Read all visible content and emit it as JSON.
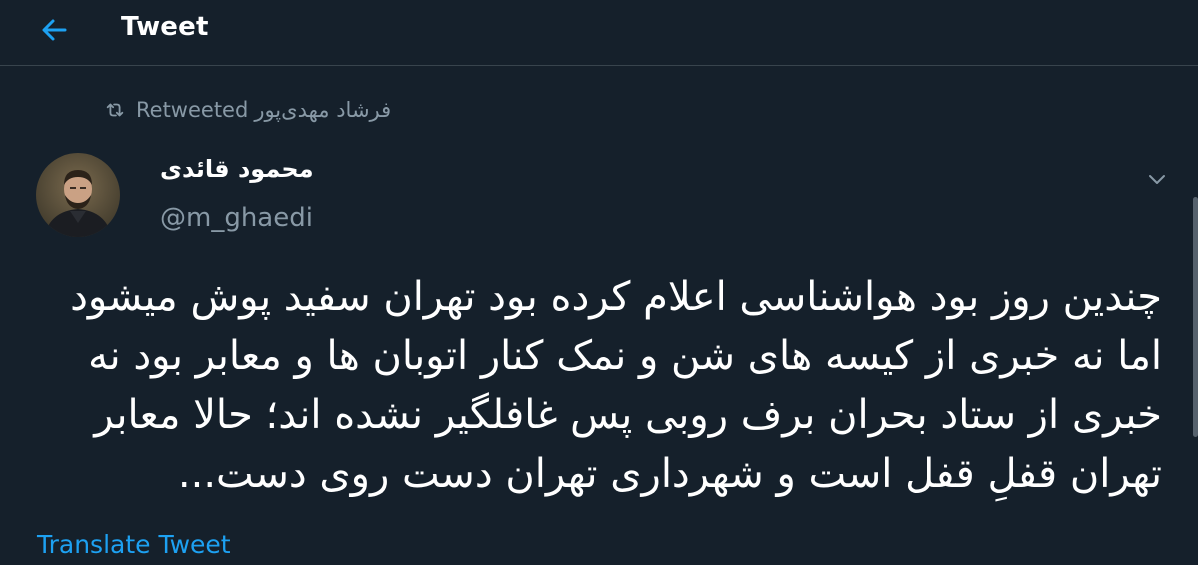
{
  "header": {
    "title": "Tweet",
    "back_icon": "arrow-left-icon"
  },
  "retweet": {
    "label": "Retweeted",
    "by": "فرشاد مهدی‌پور",
    "icon": "retweet-icon"
  },
  "author": {
    "display_name": "محمود قائدی",
    "handle": "@m_ghaedi"
  },
  "tweet": {
    "lines": [
      "چندین روز بود هواشناسی اعلام کرده بود تهران سفید پوش میشود",
      "اما نه خبری از کیسه های شن و نمک کنار اتوبان ها و معابر بود نه",
      "خبری از ستاد بحران برف روبی پس غافلگیر نشده اند؛ حالا معابر",
      "تهران قفلِ قفل است و شهرداری تهران دست روی دست..."
    ]
  },
  "translate_label": "Translate Tweet",
  "colors": {
    "background": "#15202b",
    "accent": "#1da1f2",
    "secondary_text": "#8899a6",
    "divider": "#38444d"
  }
}
